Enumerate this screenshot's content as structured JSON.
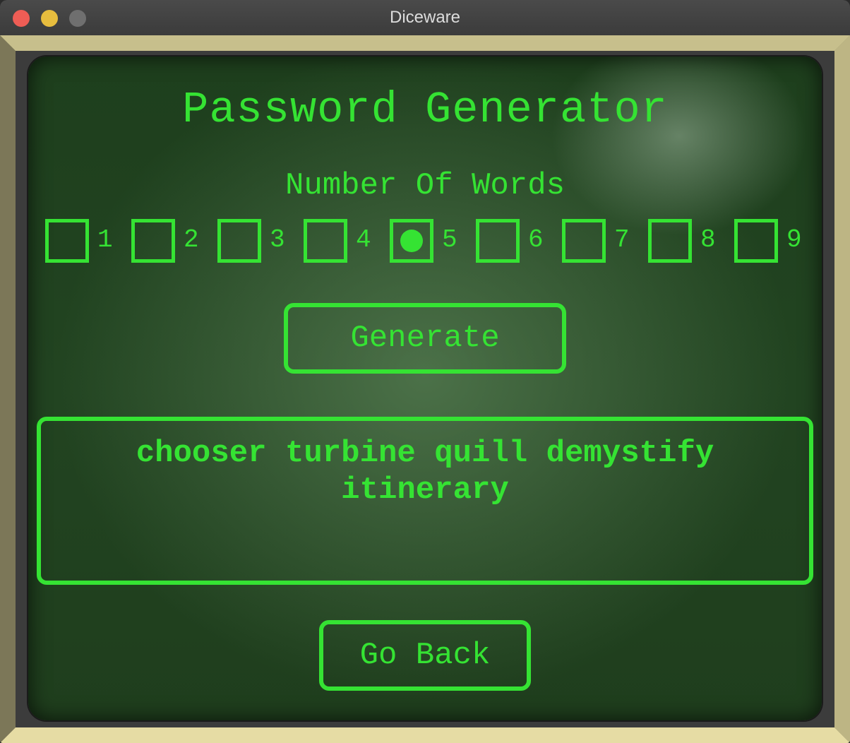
{
  "window": {
    "title": "Diceware"
  },
  "screen": {
    "heading": "Password Generator",
    "words_label": "Number Of Words",
    "options": [
      {
        "label": "1",
        "selected": false
      },
      {
        "label": "2",
        "selected": false
      },
      {
        "label": "3",
        "selected": false
      },
      {
        "label": "4",
        "selected": false
      },
      {
        "label": "5",
        "selected": true
      },
      {
        "label": "6",
        "selected": false
      },
      {
        "label": "7",
        "selected": false
      },
      {
        "label": "8",
        "selected": false
      },
      {
        "label": "9",
        "selected": false
      }
    ],
    "generate_label": "Generate",
    "output_text": "chooser turbine quill demystify itinerary",
    "go_back_label": "Go Back"
  },
  "colors": {
    "phosphor_green": "#35e333",
    "screen_background": "#224421",
    "bezel": "#c7bf8c"
  }
}
